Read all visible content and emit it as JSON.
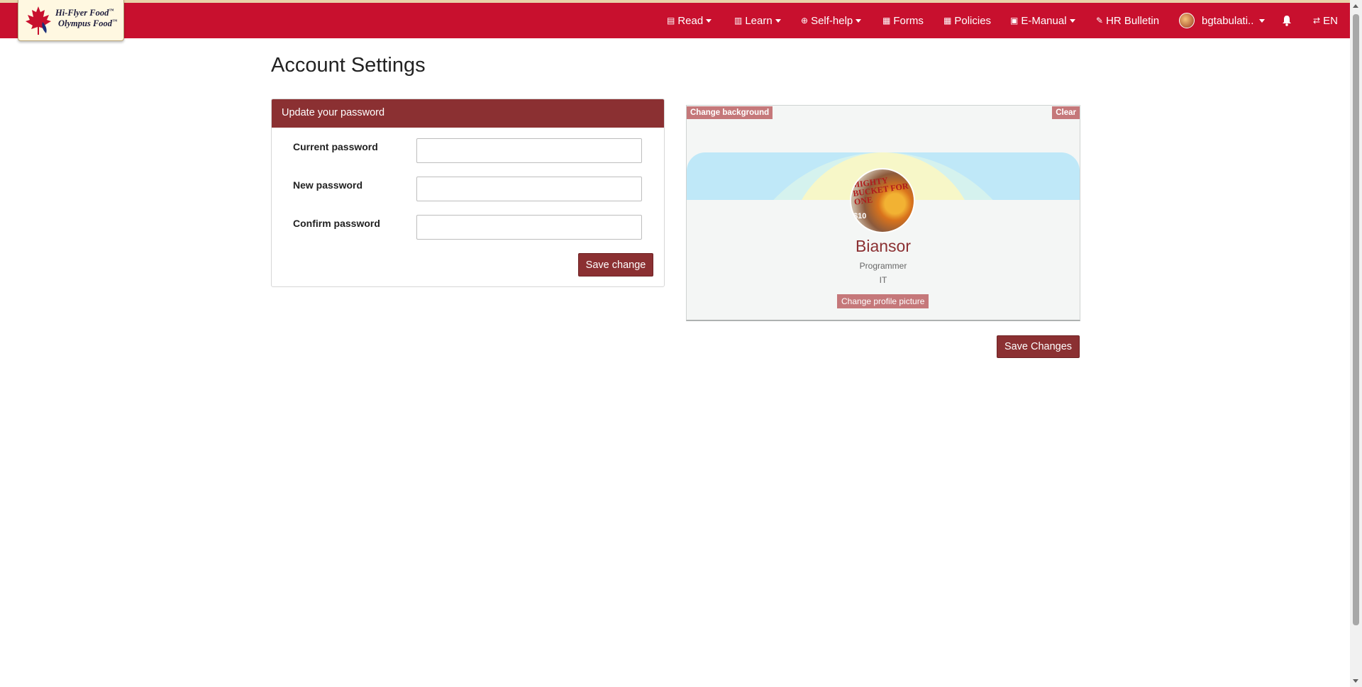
{
  "brand": {
    "line1": "Hi-Flyer Food",
    "line2": "Olympus Food",
    "tm": "™"
  },
  "nav": {
    "items": [
      {
        "label": "Read",
        "icon": "newspaper-icon",
        "dropdown": true
      },
      {
        "label": "Learn",
        "icon": "book-icon",
        "dropdown": true
      },
      {
        "label": "Self-help",
        "icon": "accessibility-icon",
        "dropdown": true
      },
      {
        "label": "Forms",
        "icon": "form-icon",
        "dropdown": false
      },
      {
        "label": "Policies",
        "icon": "policy-icon",
        "dropdown": false
      },
      {
        "label": "E-Manual",
        "icon": "manual-icon",
        "dropdown": true
      },
      {
        "label": "HR Bulletin",
        "icon": "pin-icon",
        "dropdown": false
      }
    ],
    "user": "bgtabulati..",
    "language": "EN"
  },
  "page": {
    "title": "Account Settings"
  },
  "password_panel": {
    "header": "Update your password",
    "fields": [
      {
        "label": "Current password",
        "value": ""
      },
      {
        "label": "New password",
        "value": ""
      },
      {
        "label": "Confirm password",
        "value": ""
      }
    ],
    "save_label": "Save change"
  },
  "profile": {
    "change_background_label": "Change background",
    "clear_label": "Clear",
    "name": "Biansor",
    "role": "Programmer",
    "department": "IT",
    "change_picture_label": "Change profile picture",
    "picture_promo_text": "MIGHTY BUCKET FOR ONE",
    "picture_price": "$10"
  },
  "footer": {
    "save_changes_label": "Save Changes"
  },
  "colors": {
    "navbar": "#c8102e",
    "accent": "#8b3032",
    "tag": "#c5787a"
  }
}
